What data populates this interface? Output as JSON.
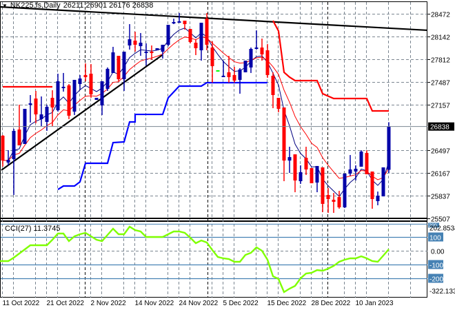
{
  "header": {
    "symbol": "NK225.fs,Daily",
    "ohlc": "26211 26901 26176 26838",
    "menu_icon": "triangle-down-icon"
  },
  "indicator": {
    "label": "CCI(27) 11.3745",
    "max_label": "202.8534",
    "min_label": "-322.133",
    "levels": [
      {
        "v": 100,
        "label": "100",
        "boxed": true
      },
      {
        "v": 0,
        "label": "0.00",
        "boxed": false
      },
      {
        "v": -100,
        "label": "-100",
        "boxed": true
      },
      {
        "v": -200,
        "label": "-200",
        "boxed": true
      }
    ],
    "top_box": "200"
  },
  "colors": {
    "bull": "#0000a8",
    "bear": "#ff0000",
    "ma_fast": "#000080",
    "ma_slow": "#ff0000",
    "step_low": "#0000ff",
    "step_high": "#ff0000",
    "cci": "#7fff00",
    "level": "#4682b4"
  },
  "chart_data": {
    "type": "candlestick",
    "title": "NK225.fs,Daily",
    "ylim": [
      25507,
      28472
    ],
    "y_ticks": [
      28472,
      28142,
      27812,
      27487,
      27157,
      26497,
      26167,
      25837,
      25507
    ],
    "current_price": 26838,
    "current_price_label": "26838",
    "x_labels": [
      {
        "i": 0,
        "label": "11 Oct 2022"
      },
      {
        "i": 8,
        "label": "21 Oct 2022"
      },
      {
        "i": 16,
        "label": "2 Nov 2022"
      },
      {
        "i": 24,
        "label": "14 Nov 2022"
      },
      {
        "i": 32,
        "label": "24 Nov 2022"
      },
      {
        "i": 40,
        "label": "5 Dec 2022"
      },
      {
        "i": 48,
        "label": "15 Dec 2022"
      },
      {
        "i": 56,
        "label": "28 Dec 2022"
      },
      {
        "i": 64,
        "label": "10 Jan 2023"
      }
    ],
    "ohlc": [
      [
        26705,
        26715,
        26256,
        26345
      ],
      [
        26316,
        26495,
        26276,
        26355
      ],
      [
        26365,
        26805,
        25846,
        26775
      ],
      [
        26795,
        27154,
        26565,
        26565
      ],
      [
        26585,
        27094,
        26585,
        27094
      ],
      [
        27154,
        27294,
        26895,
        27174
      ],
      [
        27244,
        27354,
        26885,
        27014
      ],
      [
        26945,
        27274,
        26845,
        27014
      ],
      [
        26905,
        27154,
        26775,
        27124
      ],
      [
        27254,
        27364,
        26845,
        27114
      ],
      [
        27074,
        27604,
        27054,
        27494
      ],
      [
        27404,
        27614,
        27344,
        27414
      ],
      [
        27434,
        27454,
        26945,
        26995
      ],
      [
        27054,
        27514,
        27004,
        27514
      ],
      [
        27454,
        27584,
        27374,
        27534
      ],
      [
        27584,
        27753,
        27494,
        27554
      ],
      [
        27604,
        27743,
        27254,
        27304
      ],
      [
        27224,
        27254,
        27224,
        27254
      ],
      [
        27144,
        27494,
        27004,
        27494
      ],
      [
        27384,
        27694,
        27354,
        27674
      ],
      [
        27614,
        27993,
        27614,
        27913
      ],
      [
        27863,
        27863,
        27494,
        27524
      ],
      [
        27524,
        27923,
        27354,
        27923
      ],
      [
        28013,
        28322,
        27953,
        28103
      ],
      [
        28083,
        28212,
        27923,
        28023
      ],
      [
        28003,
        28193,
        27863,
        28053
      ],
      [
        27903,
        28043,
        27723,
        27923
      ],
      [
        27923,
        28013,
        27803,
        27913
      ],
      [
        27943,
        27973,
        27943,
        27973
      ],
      [
        27923,
        28023,
        27823,
        28023
      ],
      [
        28023,
        28312,
        28003,
        28312
      ],
      [
        28342,
        28402,
        28322,
        28352
      ],
      [
        28352,
        28482,
        28342,
        28362
      ],
      [
        28372,
        28372,
        28242,
        28322
      ],
      [
        28252,
        28252,
        28043,
        28063
      ],
      [
        28053,
        28103,
        27873,
        27973
      ],
      [
        27943,
        28342,
        27793,
        28342
      ],
      [
        28402,
        28482,
        27943,
        28023
      ],
      [
        27983,
        28073,
        27474,
        27713
      ],
      [
        27654,
        27654,
        27654,
        27654
      ],
      [
        27554,
        27793,
        27554,
        27574
      ],
      [
        27624,
        27863,
        27474,
        27554
      ],
      [
        27584,
        27703,
        27474,
        27504
      ],
      [
        27514,
        27684,
        27314,
        27664
      ],
      [
        27624,
        27793,
        27624,
        27793
      ],
      [
        27694,
        27983,
        27614,
        27963
      ],
      [
        27963,
        28232,
        27953,
        27983
      ],
      [
        27983,
        28113,
        27793,
        27883
      ],
      [
        27943,
        28033,
        27544,
        27584
      ],
      [
        27574,
        27624,
        27104,
        27294
      ],
      [
        27254,
        27254,
        27044,
        27094
      ],
      [
        27114,
        27114,
        26046,
        26345
      ],
      [
        26345,
        26545,
        26166,
        26395
      ],
      [
        26435,
        26435,
        25886,
        26056
      ],
      [
        26046,
        26276,
        26006,
        26176
      ],
      [
        26385,
        26545,
        26136,
        26216
      ],
      [
        26236,
        26236,
        26016,
        26016
      ],
      [
        26026,
        26266,
        25886,
        26266
      ],
      [
        26246,
        26246,
        25597,
        25717
      ],
      [
        25846,
        25946,
        25587,
        25787
      ],
      [
        25777,
        25876,
        25587,
        25747
      ],
      [
        25816,
        25906,
        25647,
        25667
      ],
      [
        25667,
        26156,
        25657,
        26156
      ],
      [
        26156,
        26425,
        26126,
        26216
      ],
      [
        26186,
        26276,
        26056,
        26226
      ],
      [
        26256,
        26495,
        26256,
        26475
      ],
      [
        26455,
        26495,
        26146,
        26146
      ],
      [
        26186,
        26186,
        25647,
        25787
      ],
      [
        25757,
        25896,
        25697,
        25836
      ],
      [
        25826,
        26246,
        25826,
        26246
      ],
      [
        26211,
        26901,
        26166,
        26838
      ]
    ],
    "step_low": [
      [
        10,
        25926
      ],
      [
        11,
        25976
      ],
      [
        13,
        25976
      ],
      [
        14,
        26036
      ],
      [
        15,
        26306
      ],
      [
        19,
        26306
      ],
      [
        20,
        26605
      ],
      [
        22,
        26615
      ],
      [
        23,
        26905
      ],
      [
        24,
        26905
      ],
      [
        24,
        27014
      ],
      [
        29,
        27014
      ],
      [
        30,
        27254
      ],
      [
        32,
        27424
      ],
      [
        36,
        27424
      ],
      [
        37,
        27474
      ],
      [
        48,
        27474
      ]
    ],
    "step_high": [
      [
        [
          0,
          27414
        ],
        [
          9,
          27414
        ]
      ],
      [
        [
          49,
          28372
        ],
        [
          50,
          28222
        ],
        [
          51,
          27624
        ],
        [
          52,
          27554
        ],
        [
          53,
          27504
        ],
        [
          57,
          27504
        ],
        [
          58,
          27314
        ],
        [
          60,
          27244
        ],
        [
          66,
          27244
        ],
        [
          67,
          27064
        ],
        [
          70,
          27064
        ]
      ]
    ],
    "trendlines": [
      [
        [
          -0.25,
          26206
        ],
        [
          28.9,
          27873
        ]
      ],
      [
        [
          -0.5,
          28572
        ],
        [
          82,
          28233
        ]
      ]
    ],
    "support_line": 25507,
    "cci": [
      -75,
      -75,
      -50,
      -20,
      10,
      40,
      40,
      40,
      40,
      80,
      125,
      125,
      70,
      105,
      120,
      130,
      105,
      80,
      70,
      115,
      160,
      120,
      120,
      175,
      150,
      140,
      100,
      100,
      100,
      100,
      120,
      140,
      140,
      130,
      95,
      55,
      75,
      60,
      5,
      -45,
      -55,
      -60,
      -80,
      -80,
      -30,
      -15,
      25,
      0,
      -65,
      -185,
      -205,
      -300,
      -275,
      -255,
      -200,
      -165,
      -160,
      -140,
      -145,
      -130,
      -110,
      -80,
      -65,
      -55,
      -55,
      -40,
      -55,
      -75,
      -80,
      -35,
      11.3745
    ],
    "cci_ylim": [
      -322.133,
      202.8534
    ]
  }
}
